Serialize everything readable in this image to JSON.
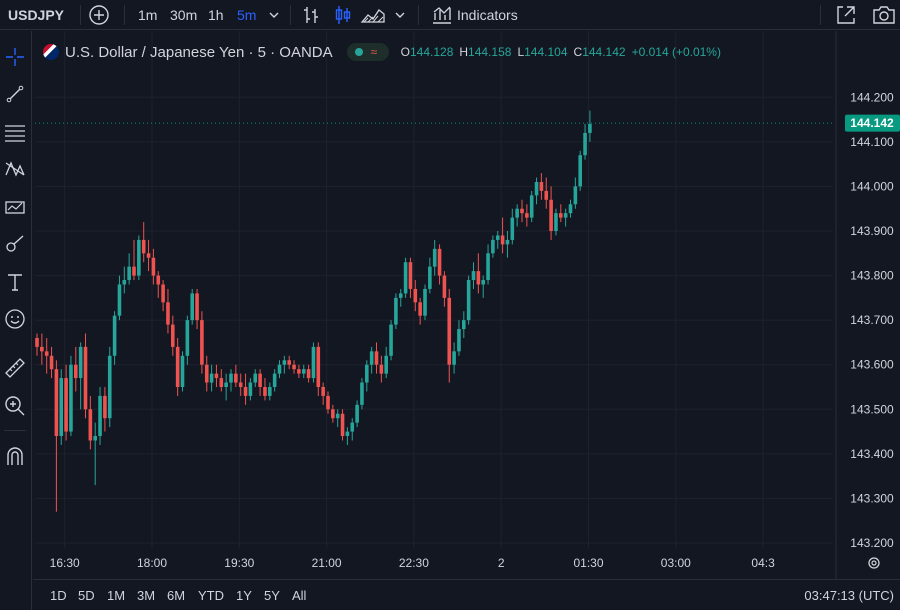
{
  "toolbar": {
    "symbol": "USDJPY",
    "intervals": [
      "1m",
      "30m",
      "1h",
      "5m"
    ],
    "active_interval": "5m",
    "indicators_label": "Indicators"
  },
  "legend": {
    "title": "U.S. Dollar / Japanese Yen · 5 · OANDA",
    "o_label": "O",
    "o_value": "144.128",
    "h_label": "H",
    "h_value": "144.158",
    "l_label": "L",
    "l_value": "144.104",
    "c_label": "C",
    "c_value": "144.142",
    "change": "+0.014 (+0.01%)",
    "pill_symbol": "≈"
  },
  "ranges": [
    "1D",
    "5D",
    "1M",
    "3M",
    "6M",
    "YTD",
    "1Y",
    "5Y",
    "All"
  ],
  "clock": "03:47:13 (UTC)",
  "colors": {
    "background": "#131722",
    "up": "#26a69a",
    "down": "#ef5350",
    "grid": "#1e222d",
    "text": "#d1d4dc",
    "accent": "#2962ff",
    "price_label": "#089981"
  },
  "chart_data": {
    "type": "candlestick",
    "title": "U.S. Dollar / Japanese Yen · 5 · OANDA",
    "last_price": 144.142,
    "ylim": [
      143.2,
      144.25
    ],
    "y_ticks": [
      "144.200",
      "144.100",
      "144.000",
      "143.900",
      "143.800",
      "143.700",
      "143.600",
      "143.500",
      "143.400",
      "143.300",
      "143.200"
    ],
    "y_tick_values": [
      144.2,
      144.1,
      144.0,
      143.9,
      143.8,
      143.7,
      143.6,
      143.5,
      143.4,
      143.3,
      143.2
    ],
    "x_ticks": [
      "16:30",
      "18:00",
      "19:30",
      "21:00",
      "22:30",
      "2",
      "01:30",
      "03:00",
      "04:3"
    ],
    "x_tick_bar_index": [
      2,
      20,
      38,
      56,
      74,
      92,
      110,
      128,
      146
    ],
    "candles": [
      [
        143.66,
        143.67,
        143.62,
        143.64
      ],
      [
        143.64,
        143.67,
        143.6,
        143.63
      ],
      [
        143.63,
        143.66,
        143.58,
        143.62
      ],
      [
        143.62,
        143.64,
        143.57,
        143.59
      ],
      [
        143.59,
        143.61,
        143.27,
        143.44
      ],
      [
        143.44,
        143.59,
        143.42,
        143.57
      ],
      [
        143.57,
        143.6,
        143.43,
        143.45
      ],
      [
        143.45,
        143.62,
        143.44,
        143.6
      ],
      [
        143.6,
        143.64,
        143.54,
        143.57
      ],
      [
        143.57,
        143.65,
        143.5,
        143.64
      ],
      [
        143.64,
        143.67,
        143.48,
        143.5
      ],
      [
        143.5,
        143.53,
        143.41,
        143.43
      ],
      [
        143.43,
        143.47,
        143.33,
        143.44
      ],
      [
        143.44,
        143.55,
        143.42,
        143.53
      ],
      [
        143.53,
        143.55,
        143.45,
        143.48
      ],
      [
        143.48,
        143.64,
        143.46,
        143.62
      ],
      [
        143.62,
        143.72,
        143.6,
        143.71
      ],
      [
        143.71,
        143.8,
        143.7,
        143.78
      ],
      [
        143.78,
        143.82,
        143.76,
        143.79
      ],
      [
        143.79,
        143.85,
        143.78,
        143.82
      ],
      [
        143.82,
        143.88,
        143.79,
        143.8
      ],
      [
        143.8,
        143.89,
        143.79,
        143.88
      ],
      [
        143.88,
        143.92,
        143.83,
        143.85
      ],
      [
        143.85,
        143.88,
        143.81,
        143.84
      ],
      [
        143.84,
        143.86,
        143.78,
        143.8
      ],
      [
        143.8,
        143.81,
        143.75,
        143.78
      ],
      [
        143.78,
        143.79,
        143.72,
        143.74
      ],
      [
        143.74,
        143.77,
        143.67,
        143.69
      ],
      [
        143.69,
        143.71,
        143.62,
        143.64
      ],
      [
        143.64,
        143.66,
        143.53,
        143.55
      ],
      [
        143.55,
        143.63,
        143.54,
        143.62
      ],
      [
        143.62,
        143.71,
        143.6,
        143.7
      ],
      [
        143.7,
        143.77,
        143.69,
        143.76
      ],
      [
        143.76,
        143.77,
        143.68,
        143.7
      ],
      [
        143.7,
        143.72,
        143.58,
        143.6
      ],
      [
        143.6,
        143.62,
        143.54,
        143.56
      ],
      [
        143.56,
        143.6,
        143.54,
        143.58
      ],
      [
        143.58,
        143.6,
        143.55,
        143.57
      ],
      [
        143.57,
        143.59,
        143.54,
        143.55
      ],
      [
        143.55,
        143.58,
        143.52,
        143.56
      ],
      [
        143.56,
        143.59,
        143.54,
        143.58
      ],
      [
        143.58,
        143.6,
        143.55,
        143.56
      ],
      [
        143.56,
        143.58,
        143.53,
        143.55
      ],
      [
        143.55,
        143.58,
        143.51,
        143.53
      ],
      [
        143.53,
        143.57,
        143.52,
        143.56
      ],
      [
        143.56,
        143.59,
        143.55,
        143.58
      ],
      [
        143.58,
        143.59,
        143.53,
        143.55
      ],
      [
        143.55,
        143.57,
        143.52,
        143.53
      ],
      [
        143.53,
        143.56,
        143.52,
        143.55
      ],
      [
        143.55,
        143.59,
        143.54,
        143.58
      ],
      [
        143.58,
        143.61,
        143.57,
        143.6
      ],
      [
        143.6,
        143.62,
        143.58,
        143.61
      ],
      [
        143.61,
        143.62,
        143.59,
        143.6
      ],
      [
        143.6,
        143.61,
        143.58,
        143.59
      ],
      [
        143.59,
        143.6,
        143.57,
        143.58
      ],
      [
        143.58,
        143.6,
        143.57,
        143.59
      ],
      [
        143.59,
        143.6,
        143.56,
        143.57
      ],
      [
        143.57,
        143.65,
        143.56,
        143.64
      ],
      [
        143.64,
        143.65,
        143.53,
        143.55
      ],
      [
        143.55,
        143.56,
        143.51,
        143.53
      ],
      [
        143.53,
        143.54,
        143.49,
        143.5
      ],
      [
        143.5,
        143.51,
        143.47,
        143.48
      ],
      [
        143.48,
        143.5,
        143.46,
        143.49
      ],
      [
        143.49,
        143.5,
        143.43,
        143.44
      ],
      [
        143.44,
        143.46,
        143.42,
        143.45
      ],
      [
        143.45,
        143.48,
        143.43,
        143.47
      ],
      [
        143.47,
        143.52,
        143.46,
        143.51
      ],
      [
        143.51,
        143.57,
        143.5,
        143.56
      ],
      [
        143.56,
        143.61,
        143.54,
        143.6
      ],
      [
        143.6,
        143.64,
        143.58,
        143.63
      ],
      [
        143.63,
        143.65,
        143.58,
        143.6
      ],
      [
        143.6,
        143.62,
        143.56,
        143.58
      ],
      [
        143.58,
        143.64,
        143.57,
        143.62
      ],
      [
        143.62,
        143.7,
        143.61,
        143.69
      ],
      [
        143.69,
        143.76,
        143.68,
        143.75
      ],
      [
        143.75,
        143.77,
        143.73,
        143.76
      ],
      [
        143.76,
        143.84,
        143.75,
        143.83
      ],
      [
        143.83,
        143.84,
        143.75,
        143.77
      ],
      [
        143.77,
        143.79,
        143.72,
        143.74
      ],
      [
        143.74,
        143.75,
        143.69,
        143.71
      ],
      [
        143.71,
        143.78,
        143.7,
        143.77
      ],
      [
        143.77,
        143.84,
        143.76,
        143.82
      ],
      [
        143.82,
        143.88,
        143.8,
        143.86
      ],
      [
        143.86,
        143.87,
        143.78,
        143.8
      ],
      [
        143.8,
        143.81,
        143.73,
        143.75
      ],
      [
        143.75,
        143.77,
        143.56,
        143.6
      ],
      [
        143.6,
        143.65,
        143.58,
        143.63
      ],
      [
        143.63,
        143.7,
        143.62,
        143.68
      ],
      [
        143.68,
        143.72,
        143.66,
        143.7
      ],
      [
        143.7,
        143.8,
        143.69,
        143.79
      ],
      [
        143.79,
        143.83,
        143.77,
        143.81
      ],
      [
        143.81,
        143.85,
        143.76,
        143.78
      ],
      [
        143.78,
        143.8,
        143.75,
        143.79
      ],
      [
        143.79,
        143.87,
        143.78,
        143.85
      ],
      [
        143.85,
        143.89,
        143.84,
        143.88
      ],
      [
        143.88,
        143.9,
        143.86,
        143.89
      ],
      [
        143.89,
        143.93,
        143.85,
        143.87
      ],
      [
        143.87,
        143.9,
        143.84,
        143.88
      ],
      [
        143.88,
        143.95,
        143.87,
        143.93
      ],
      [
        143.93,
        143.96,
        143.91,
        143.95
      ],
      [
        143.95,
        143.97,
        143.92,
        143.94
      ],
      [
        143.94,
        143.96,
        143.91,
        143.93
      ],
      [
        143.93,
        143.99,
        143.92,
        143.98
      ],
      [
        143.98,
        144.02,
        143.96,
        144.01
      ],
      [
        144.01,
        144.03,
        143.97,
        143.99
      ],
      [
        143.99,
        144.02,
        143.95,
        143.97
      ],
      [
        143.97,
        144.0,
        143.88,
        143.9
      ],
      [
        143.9,
        143.95,
        143.89,
        143.94
      ],
      [
        143.94,
        143.96,
        143.92,
        143.93
      ],
      [
        143.93,
        143.95,
        143.91,
        143.94
      ],
      [
        143.94,
        143.97,
        143.93,
        143.96
      ],
      [
        143.96,
        144.02,
        143.95,
        144.0
      ],
      [
        144.0,
        144.08,
        143.99,
        144.07
      ],
      [
        144.07,
        144.14,
        144.06,
        144.12
      ],
      [
        144.12,
        144.17,
        144.1,
        144.14
      ]
    ]
  }
}
